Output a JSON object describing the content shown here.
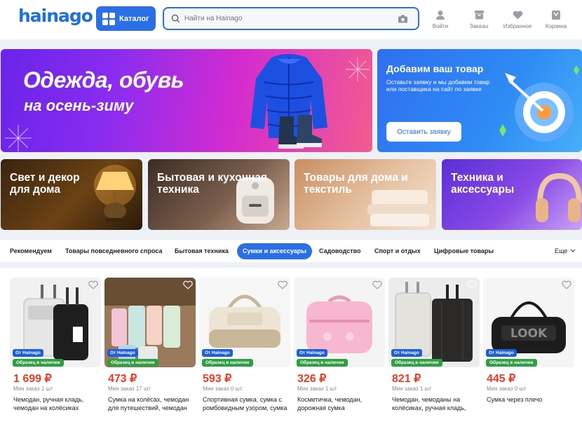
{
  "header": {
    "logo": "hainago",
    "catalog_label": "Каталог",
    "search_placeholder": "Найти на Hainago",
    "nav": [
      {
        "label": "Войти",
        "icon": "user-icon"
      },
      {
        "label": "Заказы",
        "icon": "box-icon"
      },
      {
        "label": "Избранное",
        "icon": "heart-icon"
      },
      {
        "label": "Корзина",
        "icon": "cart-icon"
      }
    ]
  },
  "banners": {
    "main": {
      "line1": "Одежда, обувь",
      "line2": "на осень-зиму"
    },
    "side": {
      "title": "Добавим ваш товар",
      "subtitle": "Оставьте заявку и мы добавим товар или поставщика на сайт по заявке",
      "button": "Оставить заявку"
    }
  },
  "categories": [
    {
      "label": "Свет и декор для дома"
    },
    {
      "label": "Бытовая и кухонная техника"
    },
    {
      "label": "Товары для дома и текстиль"
    },
    {
      "label": "Техника и аксессуары"
    }
  ],
  "tabs": [
    {
      "label": "Рекомендуем"
    },
    {
      "label": "Товары повседневного спроса"
    },
    {
      "label": "Бытовая техника"
    },
    {
      "label": "Сумки и аксессуары"
    },
    {
      "label": "Садоводство"
    },
    {
      "label": "Спорт и отдых"
    },
    {
      "label": "Цифровые товары"
    }
  ],
  "more_label": "Еще",
  "badges": {
    "from": "От Hainago",
    "stock": "Образец в наличии"
  },
  "products": [
    {
      "price": "1 699 ₽",
      "min_order": "Мин заказ 1 шт",
      "title": "Чемодан, ручная кладь, чемодан на колёсиках"
    },
    {
      "price": "473 ₽",
      "min_order": "Мин заказ 17 шт",
      "title": "Сумка на колёсах, чемодан для путешествий, чемодан"
    },
    {
      "price": "593 ₽",
      "min_order": "Мин заказ 0 шт",
      "title": "Спортивная сумка, сумка с ромбовидным узором, сумка"
    },
    {
      "price": "326 ₽",
      "min_order": "Мин заказ 1 шт",
      "title": "Косметичка, чемодан, дорожная сумка"
    },
    {
      "price": "821 ₽",
      "min_order": "Мин заказ 1 шт",
      "title": "Чемодан, чемоданы на колёсиках, ручная кладь, чемодан"
    },
    {
      "price": "445 ₽",
      "min_order": "Мин заказ 0 шт",
      "title": "Сумка через плечо"
    }
  ],
  "colors": {
    "accent": "#2a6fe6",
    "price": "#ef3b24",
    "badge_blue": "#1f5fd6",
    "badge_green": "#2ea043"
  }
}
